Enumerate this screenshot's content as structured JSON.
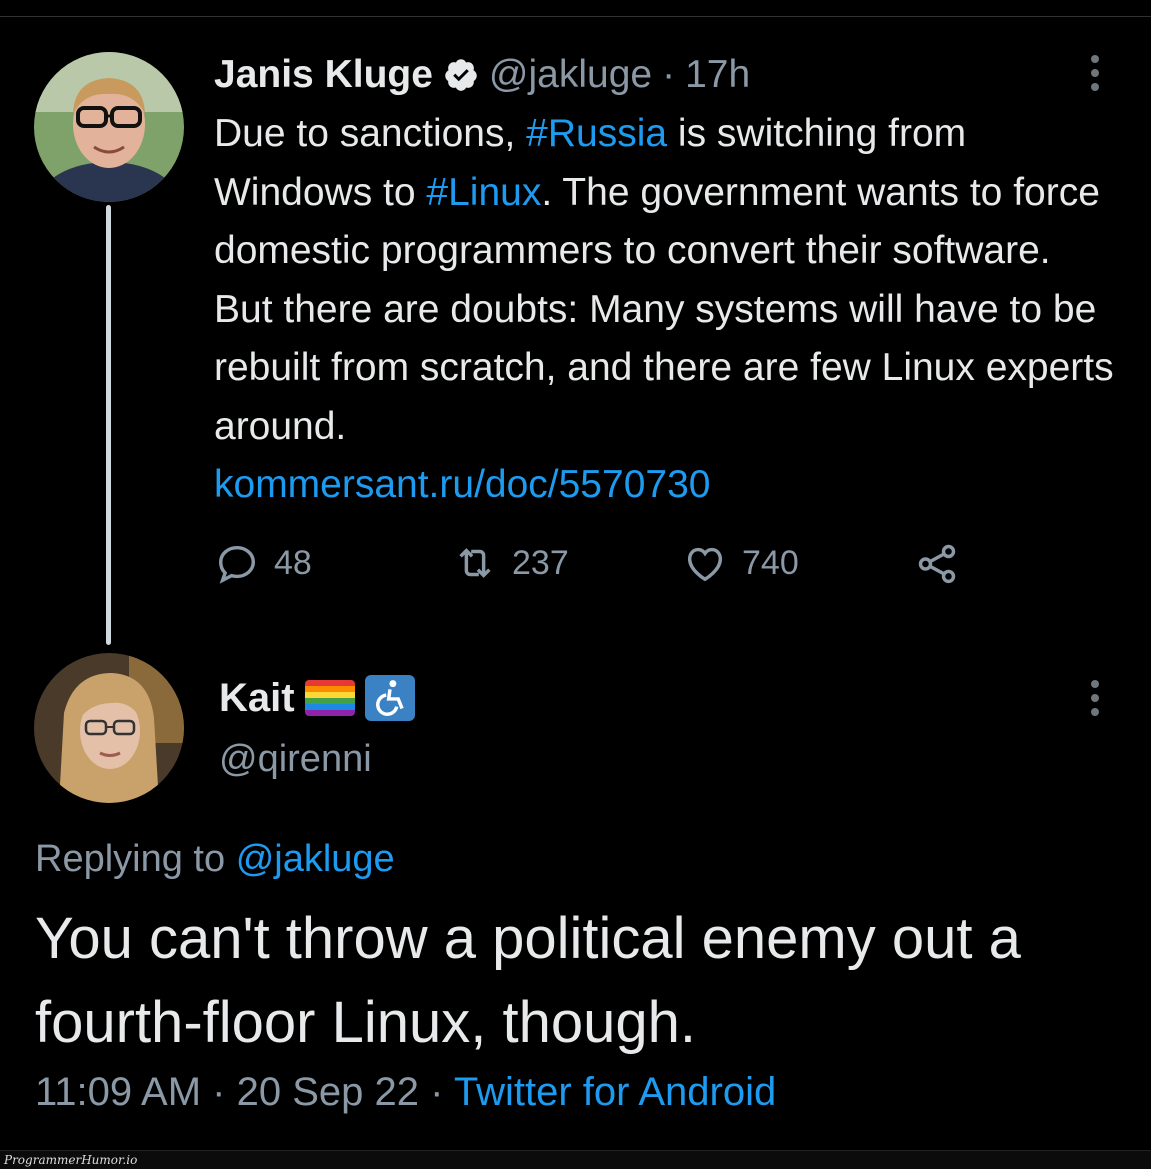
{
  "tweet1": {
    "name": "Janis Kluge",
    "handle": "@jakluge",
    "separator": "·",
    "time": "17h",
    "body": {
      "p1": "Due to sanctions, ",
      "tag1": "#Russia",
      "p2": " is switching from Windows to ",
      "tag2": "#Linux",
      "p3": ". The government wants to force domestic programmers to convert their software. But there are doubts: Many systems will have to be rebuilt from scratch, and there are few Linux experts around.",
      "link": "kommersant.ru/doc/5570730"
    },
    "actions": {
      "reply_count": "48",
      "retweet_count": "237",
      "like_count": "740"
    }
  },
  "tweet2": {
    "name": "Kait",
    "handle": "@qirenni",
    "replying_prefix": "Replying to",
    "replying_handle": "@jakluge",
    "body": "You can't throw a political enemy out a fourth-floor Linux, though.",
    "time": "11:09 AM",
    "sep1": "·",
    "date": "20 Sep 22",
    "sep2": "·",
    "source": "Twitter for Android"
  },
  "watermark": "ProgrammerHumor.io",
  "colors": {
    "background": "#000000",
    "link": "#1d9bf0",
    "muted": "#8b98a5",
    "text": "#e7e9ea"
  }
}
